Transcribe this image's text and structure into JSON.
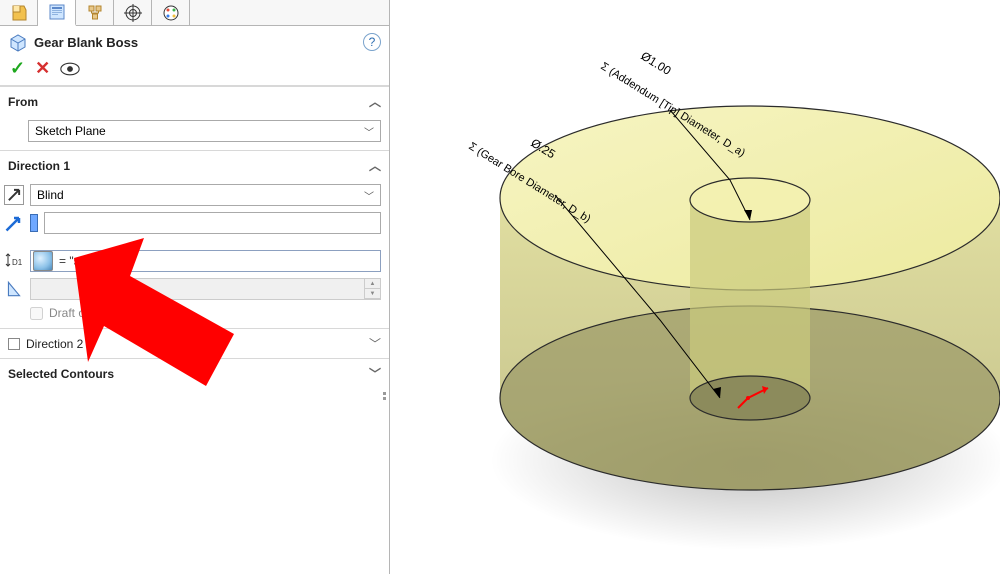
{
  "tabs": {
    "features_icon": "features-icon",
    "property_icon": "property-icon",
    "config_icon": "config-icon",
    "target_icon": "target-icon",
    "palette_icon": "palette-icon"
  },
  "feature": {
    "name": "Gear Blank Boss",
    "help": "?"
  },
  "confirm": {
    "ok": "✓",
    "cancel": "✕"
  },
  "from_section": {
    "label": "From",
    "value": "Sketch Plane"
  },
  "dir1_section": {
    "label": "Direction 1",
    "value": "Blind",
    "depth_value": "= \"s\"",
    "draft_outward": "Draft outward"
  },
  "dir2_section": {
    "label": "Direction 2"
  },
  "selected_contours": {
    "label": "Selected Contours"
  },
  "viewport": {
    "dim_outer": "Ø1.00",
    "label_outer": "Σ (Addendum [Tip] Diameter, D_a)",
    "dim_inner": "Ø.25",
    "label_inner": "Σ (Gear Bore Diameter, D_b)"
  }
}
